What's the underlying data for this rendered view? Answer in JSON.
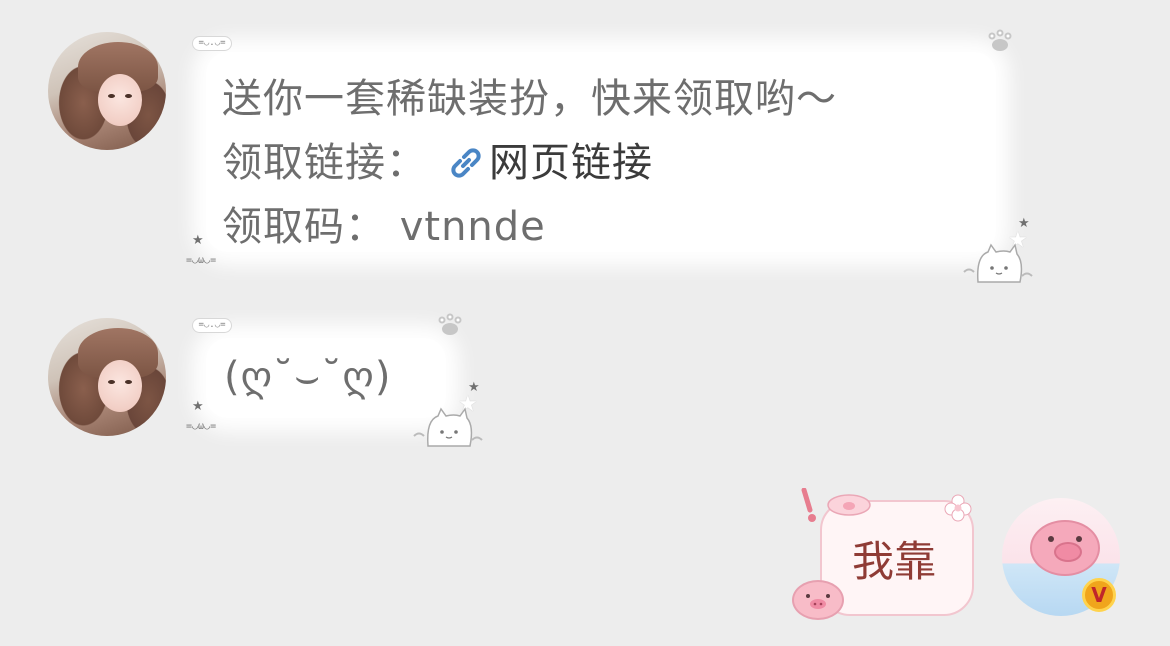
{
  "messages": [
    {
      "sender": "other",
      "lines": {
        "line1": "送你一套稀缺装扮，快来领取哟～",
        "line2_prefix": "领取链接：",
        "line2_link": "网页链接",
        "line3": "领取码：  vtnnde"
      }
    },
    {
      "sender": "other",
      "text": "(ღ˘⌣˘ღ)"
    },
    {
      "sender": "self",
      "text": "我靠"
    }
  ],
  "decor": {
    "tag_face": "=◡.◡=",
    "side_face": "=◡ω◡="
  },
  "badge": {
    "label": "V",
    "color": "#f0a51c"
  },
  "colors": {
    "background": "#ededed",
    "bubble": "#ffffff",
    "text_gray": "#6e6e6e",
    "self_bubble_border": "#f2c6cf",
    "self_text": "#8f3b35"
  },
  "icons": {
    "link": "link-icon",
    "paw": "paw-icon",
    "cat": "cat-icon",
    "pig": "pig-icon"
  }
}
